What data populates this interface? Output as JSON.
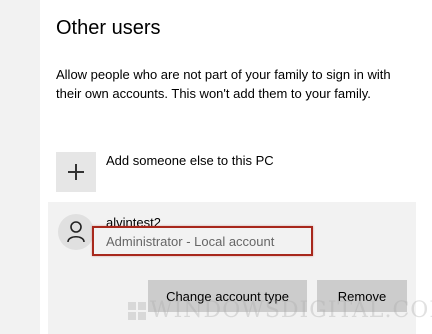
{
  "section": {
    "title": "Other users",
    "description": "Allow people who are not part of your family to sign in with their own accounts. This won't add them to your family."
  },
  "add_user": {
    "icon": "plus-icon",
    "label": "Add someone else to this PC"
  },
  "account": {
    "avatar_icon": "person-icon",
    "name": "alvintest2",
    "type": "Administrator - Local account",
    "highlight_color": "#a8281c"
  },
  "actions": {
    "change_label": "Change account type",
    "remove_label": "Remove"
  },
  "watermark": {
    "text": "WINDOWSDIGITAL.COM"
  }
}
